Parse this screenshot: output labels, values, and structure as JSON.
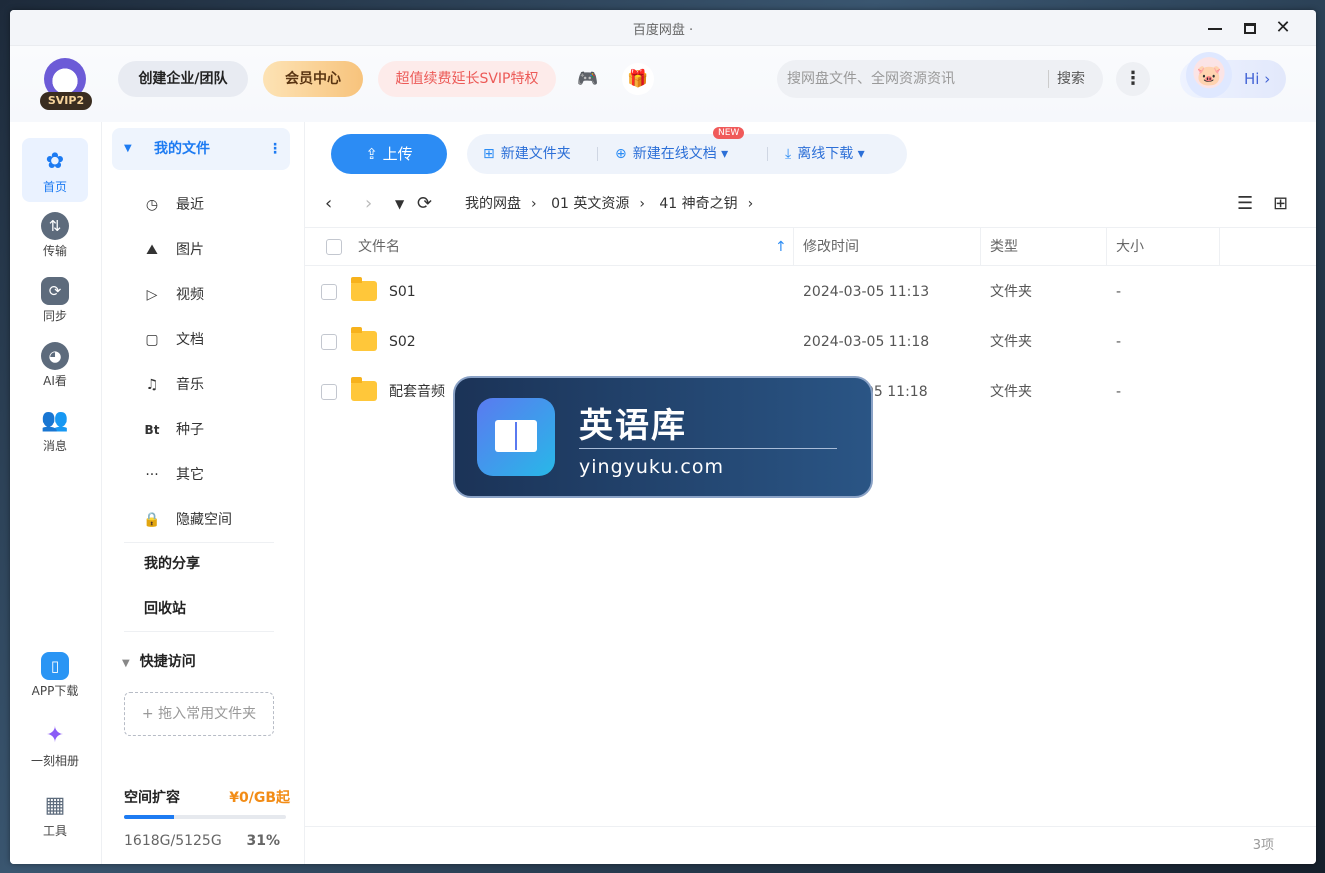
{
  "window": {
    "title": "百度网盘 ·"
  },
  "header": {
    "svip_badge": "SVIP2",
    "team_label": "创建企业/团队",
    "vip_center_label": "会员中心",
    "svip_promo_label": "超值续费延长SVIP特权",
    "search_placeholder": "搜网盘文件、全网资源资讯",
    "search_button": "搜索",
    "user_greeting": "Hi ›"
  },
  "rail": {
    "items": [
      {
        "label": "首页",
        "icon": "home-icon"
      },
      {
        "label": "传输",
        "icon": "transfer-icon"
      },
      {
        "label": "同步",
        "icon": "sync-icon"
      },
      {
        "label": "AI看",
        "icon": "ai-icon"
      },
      {
        "label": "消息",
        "icon": "message-icon"
      }
    ],
    "bottom_items": [
      {
        "label": "APP下载",
        "icon": "phone-icon"
      },
      {
        "label": "一刻相册",
        "icon": "album-icon"
      },
      {
        "label": "工具",
        "icon": "tools-icon"
      }
    ]
  },
  "sidebar": {
    "my_files": "我的文件",
    "items": [
      {
        "label": "最近",
        "icon": "clock-icon"
      },
      {
        "label": "图片",
        "icon": "image-icon"
      },
      {
        "label": "视频",
        "icon": "video-icon"
      },
      {
        "label": "文档",
        "icon": "document-icon"
      },
      {
        "label": "音乐",
        "icon": "headphones-icon"
      },
      {
        "label": "种子",
        "icon": "torrent-icon"
      },
      {
        "label": "其它",
        "icon": "more-icon"
      },
      {
        "label": "隐藏空间",
        "icon": "lock-icon"
      }
    ],
    "my_share": "我的分享",
    "recycle_bin": "回收站",
    "quick_access": "快捷访问",
    "drop_hint": "+ 拖入常用文件夹",
    "space_title": "空间扩容",
    "space_price": "¥0/GB起",
    "space_usage": "1618G/5125G",
    "space_percent": "31%",
    "space_fraction": 0.31
  },
  "toolbar": {
    "upload": "上传",
    "new_folder": "新建文件夹",
    "new_online_doc": "新建在线文档",
    "new_badge": "NEW",
    "offline_download": "离线下载"
  },
  "breadcrumb": [
    "我的网盘",
    "01 英文资源",
    "41 神奇之钥"
  ],
  "table": {
    "columns": [
      "文件名",
      "修改时间",
      "类型",
      "大小"
    ],
    "rows": [
      {
        "name": "S01",
        "modified": "2024-03-05 11:13",
        "type": "文件夹",
        "size": "-"
      },
      {
        "name": "S02",
        "modified": "2024-03-05 11:18",
        "type": "文件夹",
        "size": "-"
      },
      {
        "name": "配套音频",
        "modified": "05 11:18",
        "type": "文件夹",
        "size": "-"
      }
    ]
  },
  "footer": {
    "count": "3项"
  },
  "watermark": {
    "title": "英语库",
    "url": "yingyuku.com"
  }
}
